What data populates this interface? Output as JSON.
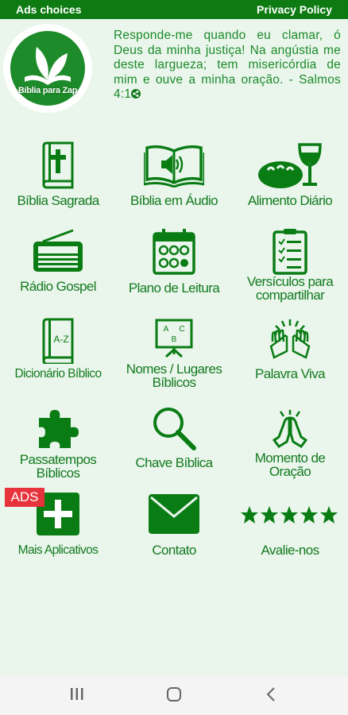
{
  "topbar": {
    "ads_choices": "Ads choices",
    "privacy_policy": "Privacy Policy"
  },
  "logo": {
    "text": "Bíblia para Zap"
  },
  "verse": {
    "text": "Responde-me quando eu clamar, ó Deus da minha justiça! Na angústia me deste largueza; tem misericórdia de mim e ouve a minha oração. - Salmos 4:1"
  },
  "colors": {
    "brand_green": "#0d7b12",
    "icon_green": "#0a7c14",
    "background": "#eaf6ec",
    "ads_red": "#e7333b"
  },
  "menu": [
    {
      "label": "Bíblia Sagrada",
      "icon": "bible-cross-icon"
    },
    {
      "label": "Bíblia em Áudio",
      "icon": "audio-book-icon"
    },
    {
      "label": "Alimento Diário",
      "icon": "bread-wine-icon"
    },
    {
      "label": "Rádio Gospel",
      "icon": "radio-icon"
    },
    {
      "label": "Plano de Leitura",
      "icon": "calendar-icon"
    },
    {
      "label_line1": "Versículos para",
      "label_line2": "compartilhar",
      "icon": "checklist-icon"
    },
    {
      "label": "Dicionário Bíblico",
      "icon": "dictionary-icon"
    },
    {
      "label_line1": "Nomes / Lugares",
      "label_line2": "Bíblicos",
      "icon": "whiteboard-icon"
    },
    {
      "label": "Palavra Viva",
      "icon": "praise-hands-icon"
    },
    {
      "label_line1": "Passatempos",
      "label_line2": "Bíblicos",
      "icon": "puzzle-icon"
    },
    {
      "label": "Chave Bíblica",
      "icon": "magnifier-icon"
    },
    {
      "label_line1": "Momento de",
      "label_line2": "Oração",
      "icon": "praying-hands-icon"
    },
    {
      "label": "Mais Aplicativos",
      "icon": "plus-icon"
    },
    {
      "label": "Contato",
      "icon": "envelope-icon"
    },
    {
      "label": "Avalie-nos",
      "icon": "stars-icon"
    }
  ],
  "ads_badge": "ADS",
  "navbar": {
    "recents": "recents-icon",
    "home": "home-icon",
    "back": "back-icon"
  }
}
